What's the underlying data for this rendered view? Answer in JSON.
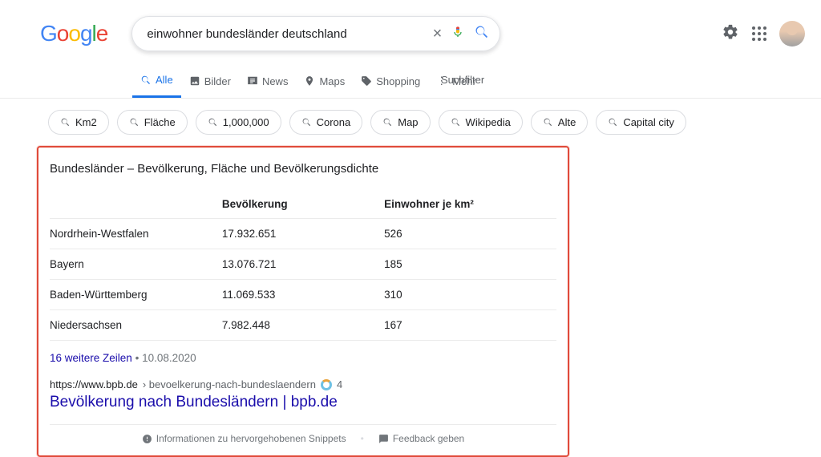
{
  "search": {
    "query": "einwohner bundesländer deutschland"
  },
  "tabs": {
    "all": "Alle",
    "images": "Bilder",
    "news": "News",
    "maps": "Maps",
    "shopping": "Shopping",
    "more": "Mehr"
  },
  "filter_link": "Suchfilter",
  "chips": [
    "Km2",
    "Fläche",
    "1,000,000",
    "Corona",
    "Map",
    "Wikipedia",
    "Alte",
    "Capital city"
  ],
  "snippet": {
    "title": "Bundesländer – Bevölkerung, Fläche und Bevölkerungsdichte",
    "headers": {
      "name": "",
      "col1": "Bevölkerung",
      "col2": "Einwohner je km²"
    },
    "rows": [
      {
        "name": "Nordrhein-Westfalen",
        "pop": "17.932.651",
        "dens": "526"
      },
      {
        "name": "Bayern",
        "pop": "13.076.721",
        "dens": "185"
      },
      {
        "name": "Baden-Württemberg",
        "pop": "11.069.533",
        "dens": "310"
      },
      {
        "name": "Niedersachsen",
        "pop": "7.982.448",
        "dens": "167"
      }
    ],
    "more_rows": "16 weitere Zeilen",
    "date": "10.08.2020",
    "cite_domain": "https://www.bpb.de",
    "cite_path": "› bevoelkerung-nach-bundeslaendern",
    "cite_badge": "4",
    "link_title": "Bevölkerung nach Bundesländern | bpb.de",
    "feedback_info": "Informationen zu hervorgehobenen Snippets",
    "feedback_give": "Feedback geben"
  }
}
